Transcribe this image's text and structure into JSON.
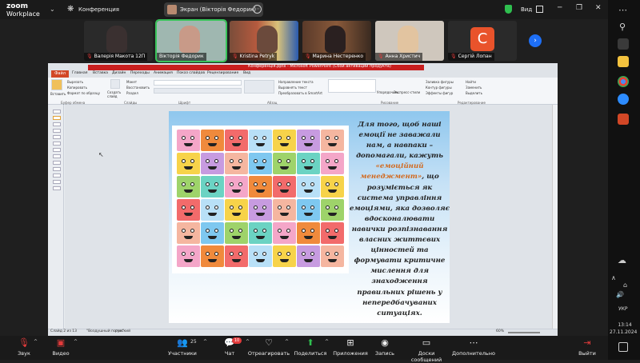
{
  "zoom": {
    "logo_line1": "zoom",
    "logo_line2": "Workplace",
    "meeting_label": "Конференция",
    "screen_share_label": "Экран (Вікторія Федорик)",
    "view_label": "Вид"
  },
  "participants": [
    {
      "name": "Валерія Макота 12П"
    },
    {
      "name": "Вікторія Федорик"
    },
    {
      "name": "Kristina Petryk"
    },
    {
      "name": "Марина Нестеренко"
    },
    {
      "name": "Анна Христич"
    },
    {
      "name": "Сергій Лопан",
      "initial": "С"
    }
  ],
  "ppt": {
    "title": "Конференція.pptx - Microsoft PowerPoint (Сбой активации продукта)",
    "menu": [
      "Файл",
      "Главная",
      "Вставка",
      "Дизайн",
      "Переходы",
      "Анимация",
      "Показ слайдов",
      "Рецензирование",
      "Вид"
    ],
    "ribbon_groups": [
      "Буфер обмена",
      "Слайды",
      "Шрифт",
      "Абзац",
      "Рисование",
      "Редактирование"
    ],
    "ribbon_buttons": [
      "Вставить",
      "Вырезать",
      "Копировать",
      "Формат по образцу",
      "Создать слайд",
      "Макет",
      "Восстановить",
      "Раздел",
      "Направление текста",
      "Выровнять текст",
      "Преобразовать в SmartArt",
      "Упорядочить",
      "Экспресс-стили",
      "Заливка фигуры",
      "Контур фигуры",
      "Эффекты фигур",
      "Найти",
      "Заменить",
      "Выделить"
    ],
    "status": {
      "slide": "Слайд 2 из 13",
      "theme": "\"Воздушный поток\"",
      "language": "русский",
      "zoom": "60%"
    }
  },
  "slide": {
    "text_part1": "Для того, щоб наші емоції не заважали нам, а навпаки – допомагали, кажуть ",
    "highlight": "«емоційний менеджмент»",
    "text_part2": ", що розуміється як система управління емоціями, яка дозволяє вдосконалювати навички розпізнавання власних життєвих цінностей та формувати критичне мислення для знаходження правильних рішень у непередбачуваних ситуаціях."
  },
  "taskbar": {
    "language": "УКР",
    "time": "13:14",
    "date": "27.11.2024"
  },
  "toolbar": {
    "audio": "Звук",
    "video": "Видео",
    "participants": "Участники",
    "participants_count": "25",
    "chat": "Чат",
    "chat_badge": "10",
    "react": "Отреагировать",
    "share": "Поделиться",
    "apps": "Приложения",
    "record": "Запись",
    "whiteboards": "Доски сообщений",
    "more": "Дополнительно",
    "leave": "Выйти"
  },
  "colors": {
    "zoom_bg": "#1a1a1a",
    "active_speaker": "#39c35a",
    "share_green": "#2fbf4f",
    "leave_red": "#e23b3b",
    "ppt_file_tab": "#d24726",
    "highlight_orange": "#d2691e"
  }
}
